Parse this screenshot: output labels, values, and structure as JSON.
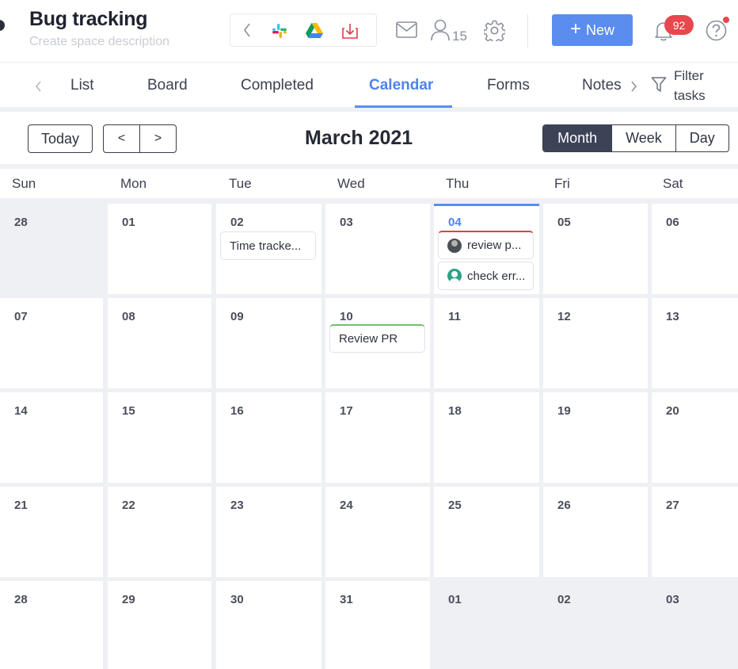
{
  "header": {
    "title": "Bug tracking",
    "description_placeholder": "Create space description",
    "members_count": "15",
    "new_button_label": "New",
    "notifications_count": "92",
    "apps": [
      "chevron-left-icon",
      "slack-icon",
      "google-drive-icon",
      "import-icon"
    ]
  },
  "tabs": {
    "items": [
      "List",
      "Board",
      "Completed",
      "Calendar",
      "Forms",
      "Notes"
    ],
    "active": "Calendar",
    "filter_label": "Filter tasks"
  },
  "toolbar": {
    "today_label": "Today",
    "prev_label": "<",
    "next_label": ">",
    "month_title": "March 2021",
    "views": [
      "Month",
      "Week",
      "Day"
    ],
    "selected_view": "Month"
  },
  "calendar": {
    "weekdays": [
      "Sun",
      "Mon",
      "Tue",
      "Wed",
      "Thu",
      "Fri",
      "Sat"
    ],
    "weeks": [
      [
        "28",
        "01",
        "02",
        "03",
        "04",
        "05",
        "06"
      ],
      [
        "07",
        "08",
        "09",
        "10",
        "11",
        "12",
        "13"
      ],
      [
        "14",
        "15",
        "16",
        "17",
        "18",
        "19",
        "20"
      ],
      [
        "21",
        "22",
        "23",
        "24",
        "25",
        "26",
        "27"
      ],
      [
        "28",
        "29",
        "30",
        "31",
        "01",
        "02",
        "03"
      ]
    ],
    "today": "04",
    "events": {
      "time_tracking": "Time tracke...",
      "review_p": "review p...",
      "check_err": "check err...",
      "review_pr": "Review PR"
    }
  },
  "colors": {
    "accent": "#5b8def",
    "badge": "#e8474d",
    "selected_view_bg": "#3d4357",
    "event_red": "#d9414a",
    "event_green": "#6fbf73"
  }
}
